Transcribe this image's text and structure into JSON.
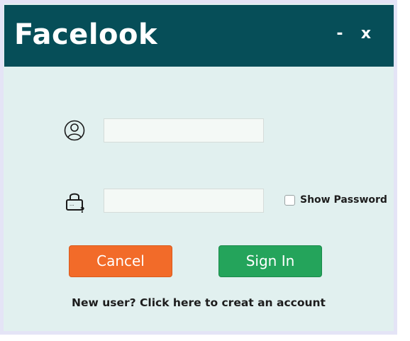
{
  "window": {
    "title": "Facelook",
    "minimize_label": "-",
    "close_label": "x"
  },
  "form": {
    "username": {
      "value": "",
      "icon": "user-icon"
    },
    "password": {
      "value": "",
      "icon": "lock-icon"
    },
    "show_password": {
      "label": "Show Password",
      "checked": false
    }
  },
  "buttons": {
    "cancel_label": "Cancel",
    "signin_label": "Sign In"
  },
  "signup_link": "New user? Click here to creat an account",
  "colors": {
    "titlebar": "#064e58",
    "background": "#e1f0ef",
    "cancel": "#f26b29",
    "signin": "#24a45b"
  }
}
